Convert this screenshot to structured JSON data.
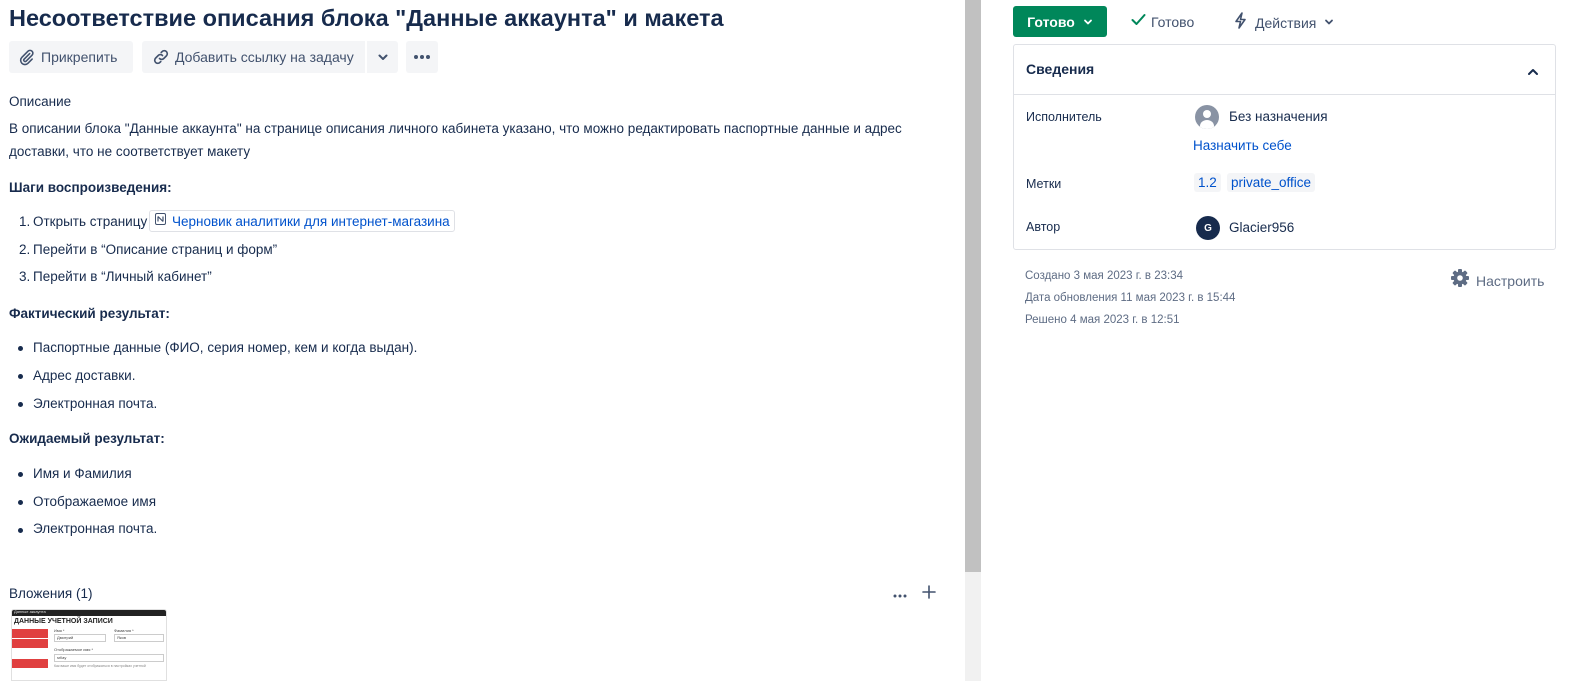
{
  "issue": {
    "title": "Несоответствие описания блока \"Данные аккаунта\" и макета"
  },
  "toolbar": {
    "attach_label": "Прикрепить",
    "link_issue_label": "Добавить ссылку на задачу"
  },
  "description": {
    "heading": "Описание",
    "line1": "В описании блока \"Данные аккаунта\" на странице описания личного кабинета указано, что можно редактировать паспортные данные и адрес",
    "line2": "доставки, что не соответствует макету",
    "steps_heading": "Шаги воспроизведения:",
    "steps": [
      {
        "num": "1.",
        "text": "Открыть страницу"
      },
      {
        "num": "2.",
        "text": "Перейти в “Описание страниц и форм”"
      },
      {
        "num": "3.",
        "text": "Перейти в “Личный кабинет”"
      }
    ],
    "step1_link": "Черновик аналитики для интернет-магазина",
    "actual_heading": "Фактический результат:",
    "actual": [
      "Паспортные данные (ФИО, серия номер, кем и когда выдан).",
      "Адрес доставки.",
      "Электронная почта."
    ],
    "expected_heading": "Ожидаемый результат:",
    "expected": [
      "Имя и Фамилия",
      "Отображаемое имя",
      "Электронная почта."
    ]
  },
  "attachments": {
    "heading": "Вложения (1)",
    "thumbnail": {
      "header_text": "Данные аккаунта",
      "title": "ДАННЫЕ УЧЕТНОЙ ЗАПИСИ",
      "menu": [
        "Информация",
        "Заказы",
        "Данные аккаунта",
        "Выйти"
      ],
      "field1_label": "Имя *",
      "field1_value": "Дмитрий",
      "field2_label": "Фамилия *",
      "field2_value": "Яков",
      "field3_label": "Отображаемое имя *",
      "field3_value": "srllay",
      "hint": "Как ваше имя будет отображаться в настройках учетной"
    }
  },
  "sidebar": {
    "status_label": "Готово",
    "resolution_label": "Готово",
    "actions_label": "Действия",
    "details_title": "Сведения",
    "assignee_label": "Исполнитель",
    "assignee_value": "Без назначения",
    "assign_self": "Назначить себе",
    "labels_label": "Метки",
    "labels": [
      "1.2",
      "private_office"
    ],
    "reporter_label": "Автор",
    "reporter_initial": "G",
    "reporter_value": "Glacier956",
    "created": "Создано 3 мая 2023 г. в 23:34",
    "updated": "Дата обновления 11 мая 2023 г. в 15:44",
    "resolved": "Решено 4 мая 2023 г. в 12:51",
    "configure_label": "Настроить"
  },
  "colors": {
    "status_green": "#00875a",
    "link_blue": "#0052cc",
    "text": "#172b4d",
    "muted": "#5e6c84"
  }
}
